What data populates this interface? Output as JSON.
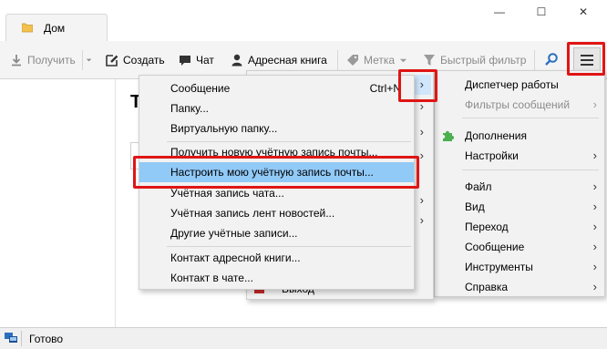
{
  "window": {
    "tab_title": "Дом",
    "minimize": "—",
    "maximize": "☐",
    "close": "✕"
  },
  "toolbar": {
    "get_label": "Получить",
    "create_label": "Создать",
    "chat_label": "Чат",
    "address_book_label": "Адресная книга",
    "tag_label": "Метка",
    "quick_filter_label": "Быстрый фильтр"
  },
  "content": {
    "partial_title": "Т"
  },
  "menus": {
    "create_submenu": {
      "items": [
        {
          "label": "Сообщение",
          "shortcut": "Ctrl+N"
        },
        {
          "label": "Папку..."
        },
        {
          "label": "Виртуальную папку..."
        },
        {
          "label": "Получить новую учётную запись почты..."
        },
        {
          "label": "Настроить мою учётную запись почты..."
        },
        {
          "label": "Учётная запись чата..."
        },
        {
          "label": "Учётная запись лент новостей..."
        },
        {
          "label": "Другие учётные записи..."
        },
        {
          "label": "Контакт адресной книги..."
        },
        {
          "label": "Контакт в чате..."
        }
      ],
      "highlighted": "Настроить мою учётную запись почты..."
    },
    "middle_menu": {
      "arrows": [
        "›",
        "›",
        "›",
        "›",
        "›",
        "›"
      ],
      "exit_label": "Выход"
    },
    "main_menu": {
      "items": [
        {
          "label": "Диспетчер работы",
          "enabled": true,
          "submenu": false
        },
        {
          "label": "Фильтры сообщений",
          "enabled": false,
          "submenu": true
        },
        {
          "label": "Дополнения",
          "enabled": true,
          "submenu": false
        },
        {
          "label": "Настройки",
          "enabled": true,
          "submenu": true
        },
        {
          "label": "Файл",
          "enabled": true,
          "submenu": true
        },
        {
          "label": "Вид",
          "enabled": true,
          "submenu": true
        },
        {
          "label": "Переход",
          "enabled": true,
          "submenu": true
        },
        {
          "label": "Сообщение",
          "enabled": true,
          "submenu": true
        },
        {
          "label": "Инструменты",
          "enabled": true,
          "submenu": true
        },
        {
          "label": "Справка",
          "enabled": true,
          "submenu": true
        }
      ]
    }
  },
  "status": {
    "text": "Готово"
  },
  "colors": {
    "highlight": "#91c9f7",
    "annotation_red": "#e01515",
    "addons_icon": "#4caf50",
    "folder_icon": "#f3c24e"
  }
}
